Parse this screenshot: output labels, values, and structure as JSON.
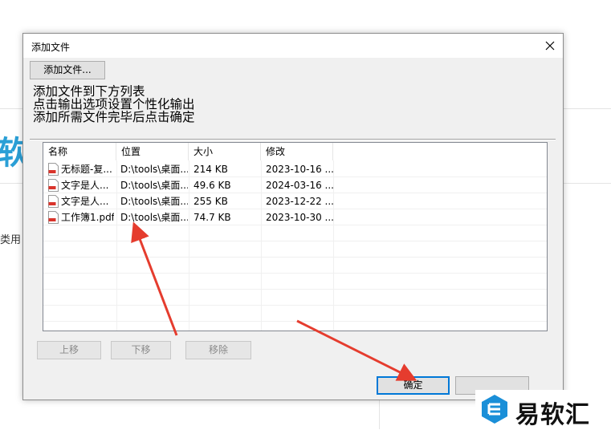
{
  "background": {
    "big_text": "软",
    "side_text": "类用"
  },
  "dialog": {
    "title": "添加文件",
    "add_button": "添加文件...",
    "instructions": [
      "添加文件到下方列表",
      "点击输出选项设置个性化输出",
      "添加所需文件完毕后点击确定"
    ],
    "columns": [
      "名称",
      "位置",
      "大小",
      "修改"
    ],
    "files": [
      {
        "icon": "pdf-icon",
        "name": "无标题-复...",
        "location": "D:\\tools\\桌面...",
        "size": "214 KB",
        "modified": "2023-10-16 ..."
      },
      {
        "icon": "pdf-icon",
        "name": "文字是人...",
        "location": "D:\\tools\\桌面...",
        "size": "49.6 KB",
        "modified": "2024-03-16 ..."
      },
      {
        "icon": "pdf-icon",
        "name": "文字是人...",
        "location": "D:\\tools\\桌面...",
        "size": "255 KB",
        "modified": "2023-12-22 ..."
      },
      {
        "icon": "pdf-icon",
        "name": "工作簿1.pdf",
        "location": "D:\\tools\\桌面...",
        "size": "74.7 KB",
        "modified": "2023-10-30 ..."
      }
    ],
    "move_up": "上移",
    "move_down": "下移",
    "remove": "移除",
    "ok": "确定"
  },
  "watermark": {
    "text": "易软汇"
  },
  "colors": {
    "arrow": "#e53c2e",
    "brand_blue": "#1a8fd8",
    "default_button_border": "#0078d7"
  }
}
